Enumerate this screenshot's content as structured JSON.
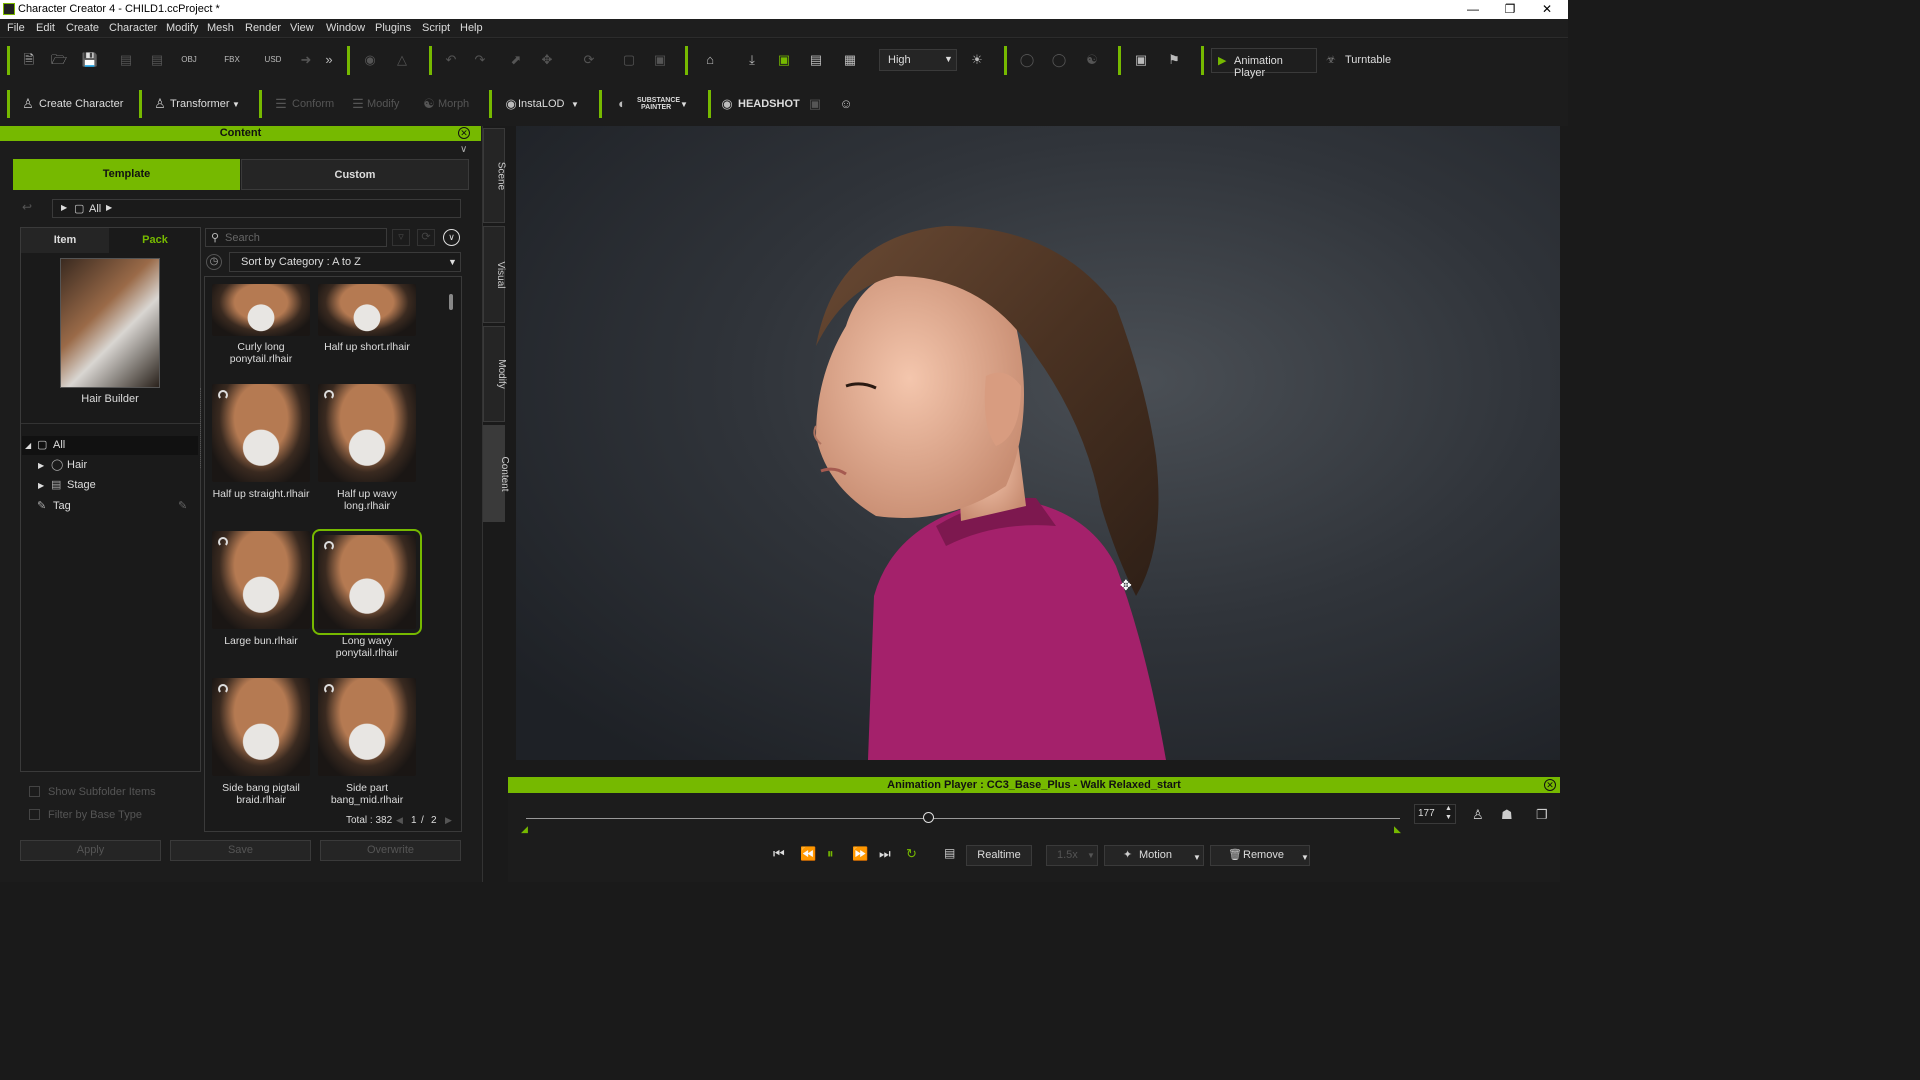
{
  "window": {
    "title": "Character Creator 4 - CHILD1.ccProject *"
  },
  "menu": [
    "File",
    "Edit",
    "Create",
    "Character",
    "Modify",
    "Mesh",
    "Render",
    "View",
    "Window",
    "Plugins",
    "Script",
    "Help"
  ],
  "toolbar1": {
    "quality_value": "High",
    "animation_player_label": "Animation Player",
    "turntable_label": "Turntable"
  },
  "toolbar2": {
    "create_character": "Create Character",
    "transformer": "Transformer",
    "conform": "Conform",
    "modify": "Modify",
    "morph": "Morph",
    "instalod": "InstaLOD",
    "substance_line1": "SUBSTANCE",
    "substance_line2": "PAINTER",
    "headshot": "HEADSHOT"
  },
  "content": {
    "header": "Content",
    "tabs": {
      "template": "Template",
      "custom": "Custom"
    },
    "path": "All",
    "subtabs": {
      "item": "Item",
      "pack": "Pack"
    },
    "pack_name": "Hair Builder",
    "search_placeholder": "Search",
    "sort_value": "Sort by Category : A to Z",
    "tree": {
      "all": "All",
      "hair": "Hair",
      "stage": "Stage",
      "tag": "Tag"
    },
    "items": [
      {
        "name": "Curly long ponytail.rlhair"
      },
      {
        "name": "Half up short.rlhair"
      },
      {
        "name": "Half up straight.rlhair"
      },
      {
        "name": "Half up wavy long.rlhair"
      },
      {
        "name": "Large bun.rlhair"
      },
      {
        "name": "Long wavy ponytail.rlhair"
      },
      {
        "name": "Side bang pigtail braid.rlhair"
      },
      {
        "name": "Side part bang_mid.rlhair"
      }
    ],
    "total": "Total : 382",
    "page_current": "1",
    "page_sep": "/",
    "page_total": "2",
    "options": {
      "show_subfolder": "Show Subfolder Items",
      "filter_base": "Filter by Base Type"
    },
    "buttons": {
      "apply": "Apply",
      "save": "Save",
      "overwrite": "Overwrite"
    }
  },
  "side_tabs": [
    "Scene",
    "Visual",
    "Modify",
    "Content"
  ],
  "animation_player": {
    "title": "Animation Player : CC3_Base_Plus - Walk Relaxed_start",
    "frame": "177",
    "realtime": "Realtime",
    "speed": "1.5x",
    "motion": "Motion",
    "remove": "Remove",
    "progress_fraction": 0.46
  },
  "colors": {
    "accent": "#76b900",
    "shirt": "#a4216b"
  }
}
